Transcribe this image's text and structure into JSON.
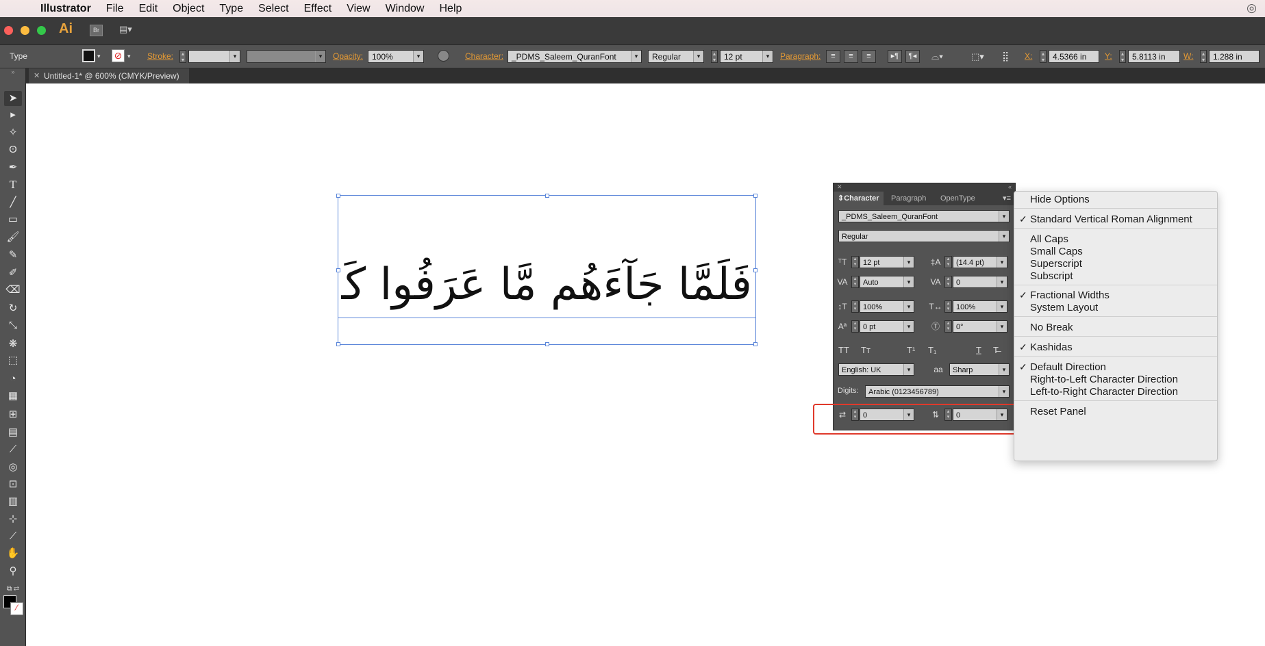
{
  "menubar": {
    "items": [
      "Illustrator",
      "File",
      "Edit",
      "Object",
      "Type",
      "Select",
      "Effect",
      "View",
      "Window",
      "Help"
    ]
  },
  "appbar": {
    "logo": "Ai",
    "bridge": "Br"
  },
  "controlbar": {
    "tool_name": "Type",
    "stroke_label": "Stroke:",
    "opacity_label": "Opacity:",
    "opacity_value": "100%",
    "character_label": "Character:",
    "font": "_PDMS_Saleem_QuranFont",
    "style": "Regular",
    "size": "12 pt",
    "paragraph_label": "Paragraph:",
    "x_label": "X:",
    "x_value": "4.5366 in",
    "y_label": "Y:",
    "y_value": "5.8113 in",
    "w_label": "W:",
    "w_value": "1.288 in"
  },
  "document": {
    "tab_title": "Untitled-1* @ 600% (CMYK/Preview)"
  },
  "canvas": {
    "text": "فَلَمَّا جَآءَهُم مَّا عَرَفُوا كَفَرُوا بِهِ"
  },
  "char_panel": {
    "tabs": [
      "Character",
      "Paragraph",
      "OpenType"
    ],
    "font": "_PDMS_Saleem_QuranFont",
    "style": "Regular",
    "font_size": "12 pt",
    "leading": "(14.4 pt)",
    "kerning": "Auto",
    "tracking": "0",
    "vertical_scale": "100%",
    "horizontal_scale": "100%",
    "baseline_shift": "0 pt",
    "rotation": "0°",
    "language": "English: UK",
    "antialias_icon": "aa",
    "antialias": "Sharp",
    "digits_label": "Digits:",
    "digits": "Arabic (0123456789)",
    "diacritics_x": "0",
    "diacritics_y": "0"
  },
  "flyout": {
    "hide_options": "Hide Options",
    "standard_vertical": "Standard Vertical Roman Alignment",
    "all_caps": "All Caps",
    "small_caps": "Small Caps",
    "superscript": "Superscript",
    "subscript": "Subscript",
    "fractional_widths": "Fractional Widths",
    "system_layout": "System Layout",
    "no_break": "No Break",
    "kashidas": "Kashidas",
    "default_direction": "Default Direction",
    "rtl_direction": "Right-to-Left Character Direction",
    "ltr_direction": "Left-to-Right Character Direction",
    "reset_panel": "Reset Panel"
  }
}
